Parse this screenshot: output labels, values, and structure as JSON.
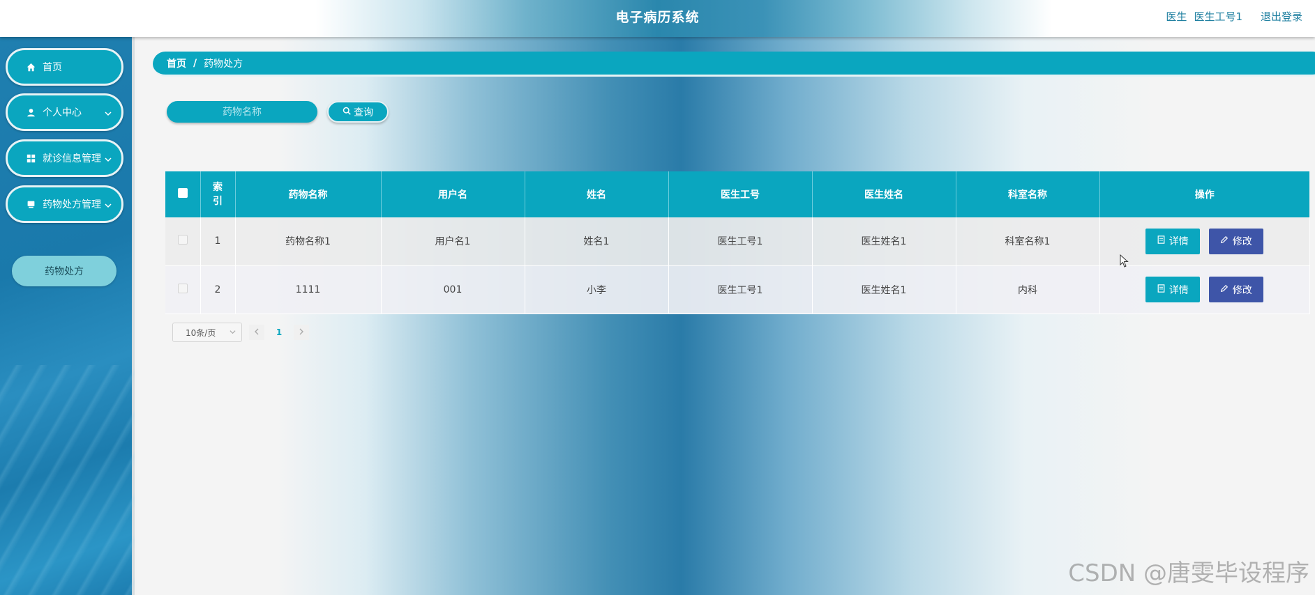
{
  "header": {
    "title": "电子病历系统",
    "role": "医生",
    "user": "医生工号1",
    "logout": "退出登录"
  },
  "sidebar": {
    "items": [
      {
        "label": "首页",
        "icon": "home-icon"
      },
      {
        "label": "个人中心",
        "icon": "user-icon"
      },
      {
        "label": "就诊信息管理",
        "icon": "grid-icon"
      },
      {
        "label": "药物处方管理",
        "icon": "box-icon"
      }
    ],
    "subitem": "药物处方"
  },
  "breadcrumb": {
    "home": "首页",
    "sep": "/",
    "current": "药物处方"
  },
  "search": {
    "placeholder": "药物名称",
    "button": "查询"
  },
  "table": {
    "index_header": "索引",
    "headers": [
      "药物名称",
      "用户名",
      "姓名",
      "医生工号",
      "医生姓名",
      "科室名称",
      "操作"
    ],
    "rows": [
      {
        "index": "1",
        "drug": "药物名称1",
        "username": "用户名1",
        "name": "姓名1",
        "doctor_id": "医生工号1",
        "doctor_name": "医生姓名1",
        "dept": "科室名称1"
      },
      {
        "index": "2",
        "drug": "1111",
        "username": "001",
        "name": "小李",
        "doctor_id": "医生工号1",
        "doctor_name": "医生姓名1",
        "dept": "内科"
      }
    ],
    "detail_label": "详情",
    "edit_label": "修改"
  },
  "pagination": {
    "page_size": "10条/页",
    "current_page": "1"
  },
  "watermark": "CSDN @唐雯毕设程序",
  "colors": {
    "accent": "#0aa6bf",
    "edit": "#3e55a8"
  }
}
